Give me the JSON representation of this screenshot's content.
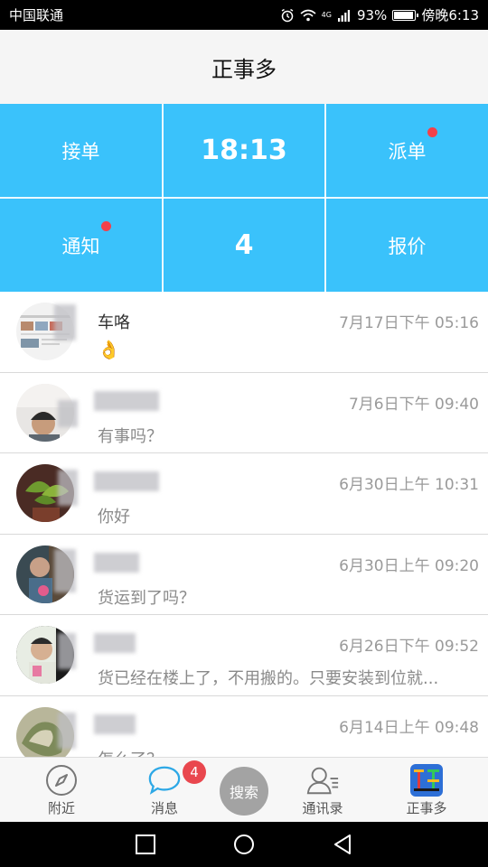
{
  "status_bar": {
    "carrier": "中国联通",
    "network": "4G",
    "battery": "93%",
    "battery_level": 0.93,
    "time": "傍晚6:13"
  },
  "header": {
    "title": "正事多"
  },
  "grid": {
    "accept": "接单",
    "clock": "18:13",
    "dispatch": "派单",
    "notice": "通知",
    "count": "4",
    "quote": "报价"
  },
  "chats": [
    {
      "name": "车咯",
      "time": "7月17日下午 05:16",
      "message": "👌"
    },
    {
      "name": "",
      "time": "7月6日下午 09:40",
      "message": "有事吗？"
    },
    {
      "name": "",
      "time": "6月30日上午 10:31",
      "message": "你好"
    },
    {
      "name": "",
      "time": "6月30日上午 09:20",
      "message": "货运到了吗？"
    },
    {
      "name": "",
      "time": "6月26日下午 09:52",
      "message": "货已经在楼上了，不用搬的。只要安装到位就..."
    },
    {
      "name": "",
      "time": "6月14日上午 09:48",
      "message": "怎么了？"
    }
  ],
  "bottom_nav": {
    "nearby": "附近",
    "messages": "消息",
    "messages_badge": "4",
    "search": "搜索",
    "contacts": "通讯录",
    "app": "正事多"
  },
  "colors": {
    "grid_bg": "#3ac2fb",
    "dot": "#f2404a",
    "badge": "#e9474e",
    "message_icon": "#2da8e6"
  }
}
